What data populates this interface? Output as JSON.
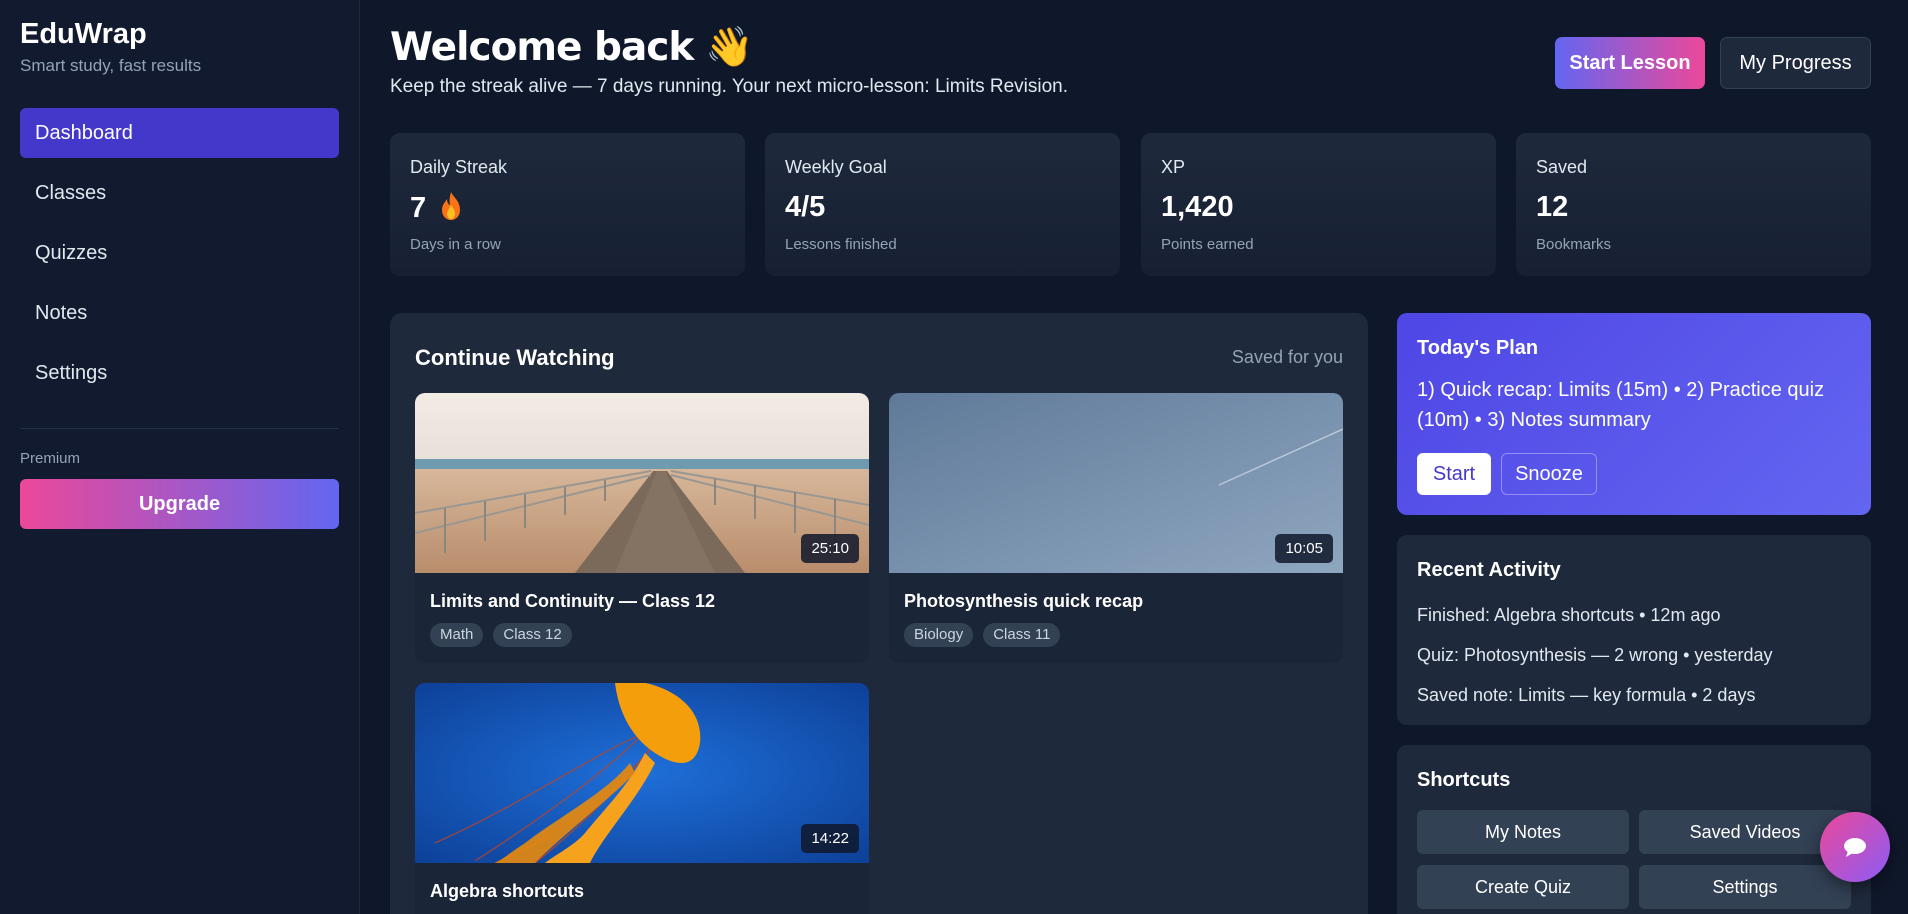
{
  "sidebar": {
    "brand": "EduWrap",
    "tagline": "Smart study, fast results",
    "items": [
      {
        "label": "Dashboard",
        "active": true
      },
      {
        "label": "Classes"
      },
      {
        "label": "Quizzes"
      },
      {
        "label": "Notes"
      },
      {
        "label": "Settings"
      }
    ],
    "premium_label": "Premium",
    "upgrade_label": "Upgrade"
  },
  "header": {
    "title": "Welcome back",
    "emoji": "👋",
    "subtitle": "Keep the streak alive — 7 days running. Your next micro-lesson: Limits Revision.",
    "start_lesson_label": "Start Lesson",
    "progress_label": "My Progress"
  },
  "stats": [
    {
      "label": "Daily Streak",
      "value": "7",
      "sub": "Days in a row",
      "icon": "fire-icon"
    },
    {
      "label": "Weekly Goal",
      "value": "4/5",
      "sub": "Lessons finished"
    },
    {
      "label": "XP",
      "value": "1,420",
      "sub": "Points earned"
    },
    {
      "label": "Saved",
      "value": "12",
      "sub": "Bookmarks"
    }
  ],
  "continue_watching": {
    "title": "Continue Watching",
    "saved_label": "Saved for you",
    "videos": [
      {
        "title": "Limits and Continuity — Class 12",
        "duration": "25:10",
        "tags": [
          "Math",
          "Class 12"
        ],
        "thumbnail": "boardwalk-beach"
      },
      {
        "title": "Photosynthesis quick recap",
        "duration": "10:05",
        "tags": [
          "Biology",
          "Class 11"
        ],
        "thumbnail": "blue-sky"
      },
      {
        "title": "Algebra shortcuts",
        "duration": "14:22",
        "tags": [],
        "thumbnail": "jellyfish"
      }
    ]
  },
  "plan": {
    "title": "Today's Plan",
    "text": "1) Quick recap: Limits (15m) • 2) Practice quiz (10m) • 3) Notes summary",
    "start_label": "Start",
    "snooze_label": "Snooze"
  },
  "activity": {
    "title": "Recent Activity",
    "items": [
      "Finished: Algebra shortcuts • 12m ago",
      "Quiz: Photosynthesis — 2 wrong • yesterday",
      "Saved note: Limits — key formula • 2 days"
    ]
  },
  "shortcuts": {
    "title": "Shortcuts",
    "items": [
      "My Notes",
      "Saved Videos",
      "Create Quiz",
      "Settings"
    ]
  },
  "colors": {
    "background": "#0f172a",
    "sidebar": "#111a2e",
    "card": "#1e293b",
    "accent": "#4338ca",
    "pink": "#ec4899",
    "indigo": "#6366f1"
  }
}
